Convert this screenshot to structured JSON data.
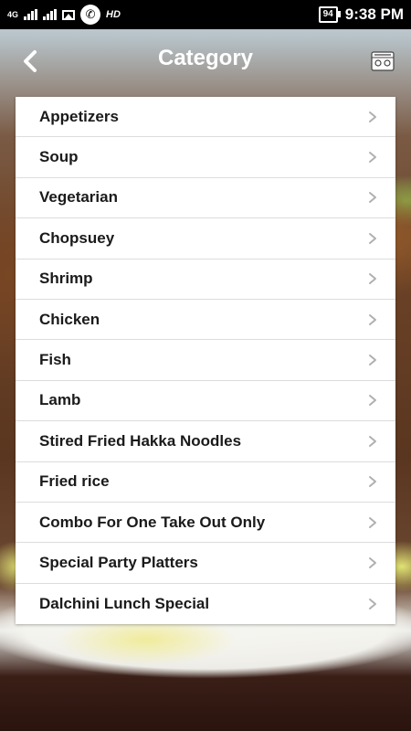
{
  "status_bar": {
    "network": "4G",
    "hd": "HD",
    "battery": "94",
    "time": "9:38 PM"
  },
  "header": {
    "title": "Category"
  },
  "categories": [
    {
      "label": "Appetizers"
    },
    {
      "label": "Soup"
    },
    {
      "label": "Vegetarian"
    },
    {
      "label": "Chopsuey"
    },
    {
      "label": "Shrimp"
    },
    {
      "label": "Chicken"
    },
    {
      "label": "Fish"
    },
    {
      "label": "Lamb"
    },
    {
      "label": "Stired Fried Hakka Noodles"
    },
    {
      "label": "Fried rice"
    },
    {
      "label": "Combo For One Take Out Only"
    },
    {
      "label": "Special Party Platters"
    },
    {
      "label": "Dalchini Lunch Special"
    }
  ],
  "icons": {
    "back": "chevron-left-icon",
    "cart": "cart-icon",
    "row_chevron": "chevron-right-icon"
  },
  "colors": {
    "status_bar": "#000000",
    "chevron": "#b0b0b0",
    "text": "#1a1a1a"
  }
}
